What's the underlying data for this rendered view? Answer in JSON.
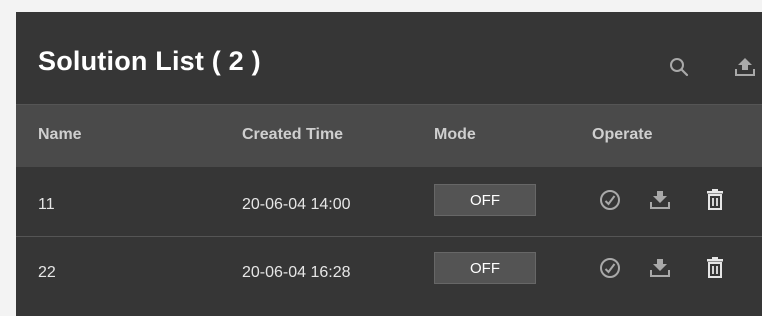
{
  "header": {
    "title": "Solution List  ( 2 )",
    "search_icon": "search-icon",
    "upload_icon": "upload-icon"
  },
  "table": {
    "columns": [
      "Name",
      "Created Time",
      "Mode",
      "Operate"
    ],
    "rows": [
      {
        "name": "11",
        "created_time": "20-06-04 14:00",
        "mode": "OFF",
        "operate_icons": [
          "apply-icon",
          "download-icon",
          "delete-icon"
        ]
      },
      {
        "name": "22",
        "created_time": "20-06-04 16:28",
        "mode": "OFF",
        "operate_icons": [
          "apply-icon",
          "download-icon",
          "delete-icon"
        ]
      }
    ]
  },
  "colors": {
    "panel_bg": "#363636",
    "header_row_bg": "#4a4a4a",
    "text": "#e6e6e6",
    "icon": "#a9a9a9"
  }
}
